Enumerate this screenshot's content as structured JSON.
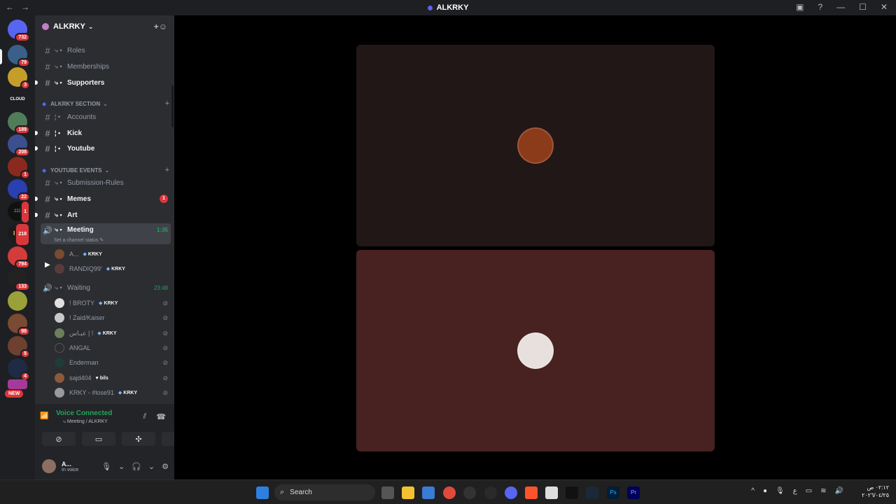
{
  "window": {
    "title": "ALKRKY",
    "back_icon": "←",
    "forward_icon": "→"
  },
  "guild_badges": [
    "732",
    "79",
    "3",
    "189",
    "208",
    "1",
    "22",
    "1",
    "218",
    "794",
    "133",
    "98",
    "5",
    "4",
    "NEW"
  ],
  "guild_labels": {
    "cloud": "CLOUD",
    "gv": "222",
    "pm": "PM"
  },
  "server": {
    "name": "ALKRKY",
    "caret": "⌄"
  },
  "channels_top": [
    {
      "name": "Roles",
      "prefix": "⤷ •"
    },
    {
      "name": "Memberships",
      "prefix": "⤷ •"
    },
    {
      "name": "Supporters",
      "prefix": "⤷ •"
    }
  ],
  "categories": {
    "alkrky": "ALKRKY SECTION",
    "youtube": "YOUTUBE EVENTS"
  },
  "channels_mid": [
    {
      "name": "Accounts",
      "prefix": "¦ •"
    },
    {
      "name": "Kick",
      "prefix": "¦ •"
    },
    {
      "name": "Youtube",
      "prefix": "¦ •"
    }
  ],
  "channels_yt": [
    {
      "name": "Submission-Rules",
      "prefix": "⤷ •"
    },
    {
      "name": "Memes",
      "prefix": "⤷ •",
      "mention": "1"
    },
    {
      "name": "Art",
      "prefix": "⤷ •"
    }
  ],
  "voice_meeting": {
    "name": "Meeting",
    "prefix": "⤷ •",
    "time": "1:35",
    "status": "Set a channel status ✎"
  },
  "meeting_members": [
    {
      "name": "A...",
      "tag": "KRKY"
    },
    {
      "name": "RANDIQ99'",
      "tag": "KRKY"
    }
  ],
  "voice_waiting": {
    "name": "Waiting",
    "prefix": "⤷ •",
    "time": "23:49"
  },
  "waiting_members": [
    {
      "name": "! BROTY",
      "tag": "KRKY"
    },
    {
      "name": "! Zaid/Kaiser",
      "tag": ""
    },
    {
      "name": "عبـاس | !",
      "tag": "KRKY"
    },
    {
      "name": "ANGAL",
      "tag": ""
    },
    {
      "name": "Enderman",
      "tag": ""
    },
    {
      "name": "sajd404",
      "tag": "bils"
    },
    {
      "name": "KRKY - #lose91",
      "tag": "KRKY"
    }
  ],
  "voice_panel": {
    "connected": "Voice Connected",
    "location": "⤷ Meeting / ALKRKY",
    "user": "A...",
    "user_status": "In voice"
  },
  "taskbar": {
    "search": "Search",
    "lang": "ع",
    "time": "٠٢:١٢ ص",
    "date": "٢٠٢٦/٠٤/٢٥"
  },
  "colors": {
    "accent": "#5865f2",
    "green": "#23a55a",
    "red": "#da373c",
    "tile_top": "#211716",
    "tile_bottom": "#472220"
  }
}
